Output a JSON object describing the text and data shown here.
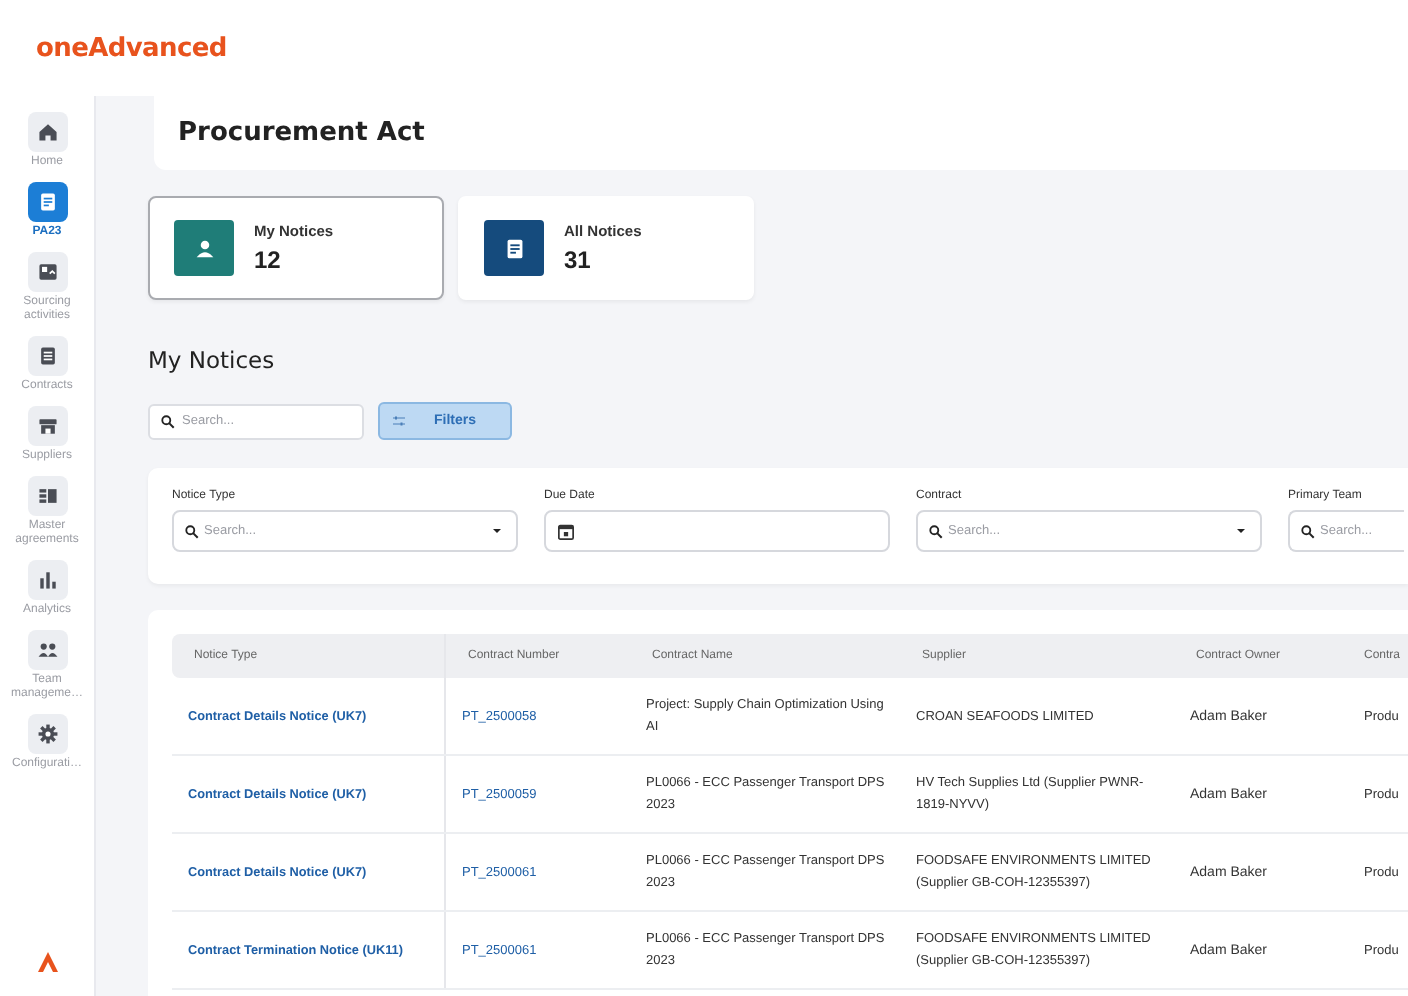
{
  "header": {
    "logo": "oneAdvanced"
  },
  "sidebar": {
    "items": [
      {
        "label": "Home",
        "kind": "home",
        "selected": false
      },
      {
        "label": "PA23",
        "kind": "document",
        "selected": true
      },
      {
        "label": "Sourcing activities",
        "kind": "board",
        "selected": false
      },
      {
        "label": "Contracts",
        "kind": "list",
        "selected": false
      },
      {
        "label": "Suppliers",
        "kind": "store",
        "selected": false
      },
      {
        "label": "Master agreements",
        "kind": "columns",
        "selected": false
      },
      {
        "label": "Analytics",
        "kind": "bars",
        "selected": false
      },
      {
        "label": "Team manageme…",
        "kind": "people",
        "selected": false
      },
      {
        "label": "Configurati…",
        "kind": "gear",
        "selected": false
      }
    ]
  },
  "page_title": "Procurement Act",
  "summary_cards": [
    {
      "label": "My Notices",
      "count": "12",
      "kind": "person",
      "color": "#1f7d78",
      "selected": true
    },
    {
      "label": "All Notices",
      "count": "31",
      "kind": "document",
      "color": "#154b7d",
      "selected": false
    }
  ],
  "section_title": "My Notices",
  "search": {
    "placeholder": "Search..."
  },
  "filters_button": {
    "label": "Filters"
  },
  "filters": [
    {
      "label": "Notice Type",
      "kind": "select",
      "placeholder": "Search..."
    },
    {
      "label": "Due Date",
      "kind": "date"
    },
    {
      "label": "Contract",
      "kind": "select",
      "placeholder": "Search..."
    },
    {
      "label": "Primary Team",
      "kind": "search",
      "placeholder": "Search..."
    }
  ],
  "table": {
    "columns": [
      {
        "label": "Notice Type",
        "kind": "link"
      },
      {
        "label": "Contract Number",
        "kind": "link"
      },
      {
        "label": "Contract Name",
        "kind": "text"
      },
      {
        "label": "Supplier",
        "kind": "text"
      },
      {
        "label": "Contract Owner",
        "kind": "text"
      },
      {
        "label": "Contra",
        "kind": "text"
      }
    ],
    "rows": [
      {
        "cells": [
          "Contract Details Notice (UK7)",
          "PT_2500058",
          "Project: Supply Chain Optimization Using AI",
          "CROAN SEAFOODS LIMITED",
          "Adam Baker",
          "Produ"
        ]
      },
      {
        "cells": [
          "Contract Details Notice (UK7)",
          "PT_2500059",
          "PL0066 - ECC Passenger Transport DPS 2023",
          "HV Tech Supplies Ltd (Supplier PWNR-1819-NYVV)",
          "Adam Baker",
          "Produ"
        ]
      },
      {
        "cells": [
          "Contract Details Notice (UK7)",
          "PT_2500061",
          "PL0066 - ECC Passenger Transport DPS 2023",
          "FOODSAFE ENVIRONMENTS LIMITED (Supplier GB-COH-12355397)",
          "Adam Baker",
          "Produ"
        ]
      },
      {
        "cells": [
          "Contract Termination Notice (UK11)",
          "PT_2500061",
          "PL0066 - ECC Passenger Transport DPS 2023",
          "FOODSAFE ENVIRONMENTS LIMITED (Supplier GB-COH-12355397)",
          "Adam Baker",
          "Produ"
        ]
      }
    ]
  }
}
